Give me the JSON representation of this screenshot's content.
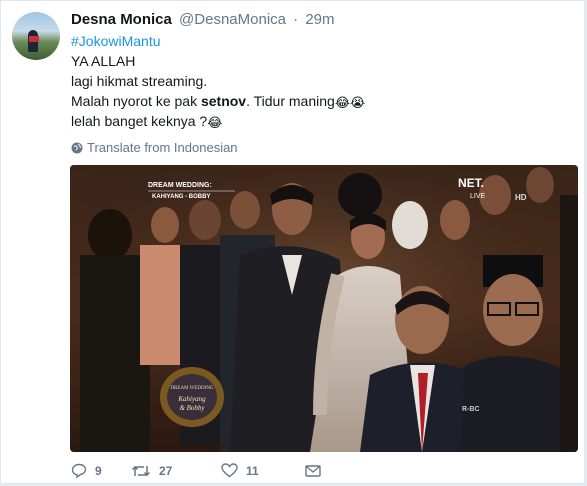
{
  "tweet": {
    "author_name": "Desna Monica",
    "author_handle": "@DesnaMonica",
    "separator": "·",
    "timestamp": "29m",
    "hashtag": "#JokowiMantu",
    "line1": "YA ALLAH",
    "line2": "lagi hikmat streaming.",
    "line3_prefix": "Malah nyorot ke pak ",
    "line3_bold": "setnov",
    "line3_suffix": ". Tidur maning",
    "line3_emojis": "😂😭",
    "line4": "lelah banget keknya ?",
    "line4_emoji": "😂",
    "translate_label": "Translate from Indonesian"
  },
  "media": {
    "caption_title": "DREAM WEDDING:",
    "caption_sub": "KAHIYANG - BOBBY",
    "channel_logo": "NET.",
    "channel_live": "LIVE",
    "hd_badge": "HD",
    "watermark": "R-BC"
  },
  "actions": {
    "reply_count": "9",
    "retweet_count": "27",
    "like_count": "11"
  },
  "colors": {
    "link": "#1b95e0",
    "text": "#14171a",
    "muted": "#657786"
  }
}
